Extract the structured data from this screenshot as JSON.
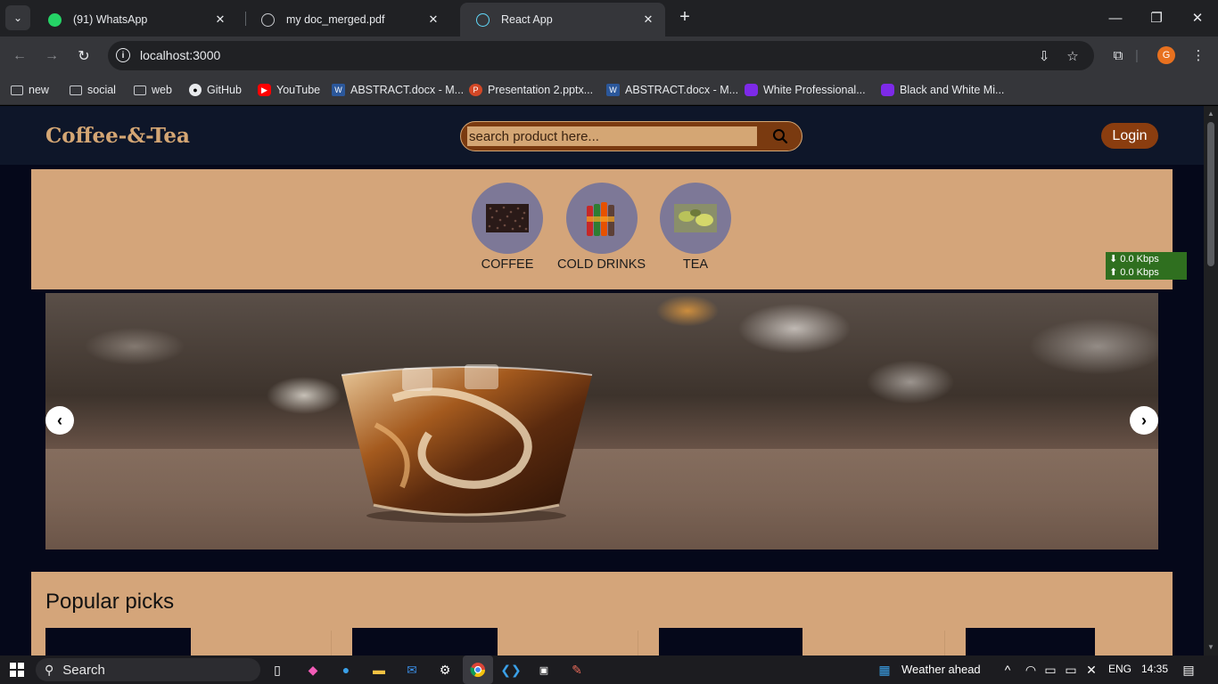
{
  "browser": {
    "tabs": [
      {
        "title": "(91) WhatsApp",
        "icon": "whatsapp-icon"
      },
      {
        "title": "my doc_merged.pdf",
        "icon": "globe-icon"
      },
      {
        "title": "React App",
        "icon": "react-icon"
      }
    ],
    "url": "localhost:3000",
    "profile_initial": "G",
    "bookmarks": [
      {
        "label": "new",
        "icon": "folder-icon"
      },
      {
        "label": "social",
        "icon": "folder-icon"
      },
      {
        "label": "web",
        "icon": "folder-icon"
      },
      {
        "label": "GitHub",
        "icon": "github-icon"
      },
      {
        "label": "YouTube",
        "icon": "youtube-icon"
      },
      {
        "label": "ABSTRACT.docx - M...",
        "icon": "word-icon"
      },
      {
        "label": "Presentation 2.pptx...",
        "icon": "powerpoint-icon"
      },
      {
        "label": "ABSTRACT.docx - M...",
        "icon": "word-icon"
      },
      {
        "label": "White Professional...",
        "icon": "canva-icon"
      },
      {
        "label": "Black and White Mi...",
        "icon": "canva-icon"
      }
    ]
  },
  "site": {
    "brand": "Coffee-&-Tea",
    "search_placeholder": "search product here...",
    "login_label": "Login",
    "categories": [
      {
        "label": "COFFEE"
      },
      {
        "label": "COLD DRINKS"
      },
      {
        "label": "TEA"
      }
    ],
    "prev_label": "‹",
    "next_label": "›",
    "popular_title": "Popular picks"
  },
  "netspeed": {
    "down": "⬇ 0.0 Kbps",
    "up": "⬆ 0.0 Kbps"
  },
  "taskbar": {
    "search_label": "Search",
    "weather": "Weather ahead",
    "language": "ENG",
    "time": "14:35"
  },
  "colors": {
    "accent": "#d4a674",
    "button": "#8a3d0f",
    "page_bg": "#05081a",
    "panel": "#d4a57a"
  }
}
